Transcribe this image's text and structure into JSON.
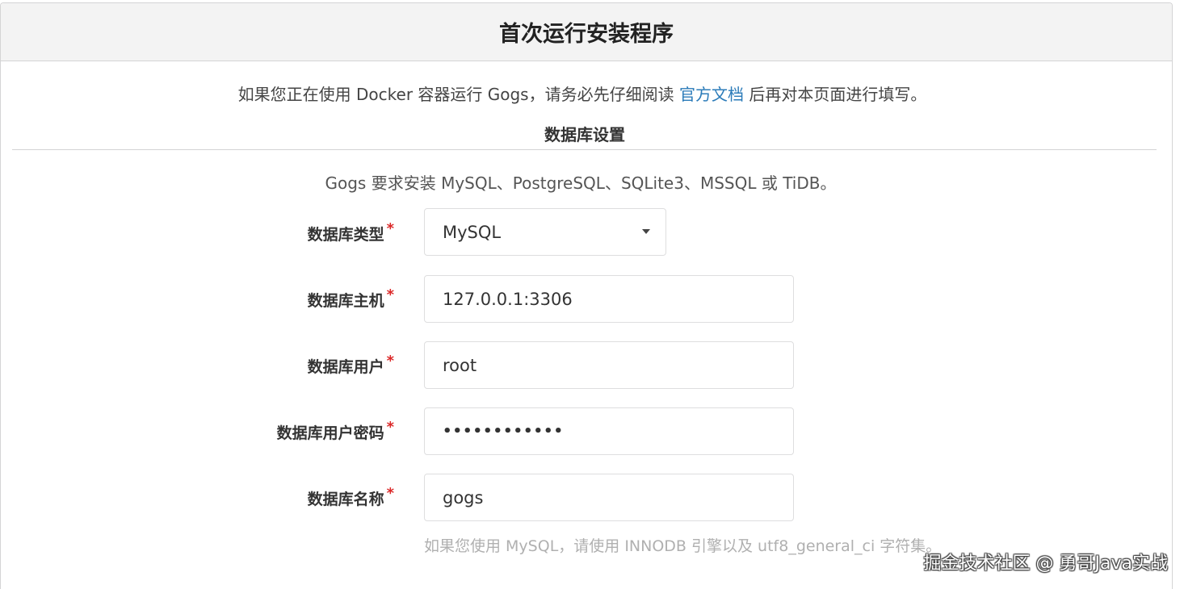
{
  "page": {
    "title": "首次运行安装程序"
  },
  "notice": {
    "before_link": "如果您正在使用 Docker 容器运行 Gogs，请务必先仔细阅读",
    "link_text": "官方文档",
    "after_link": "后再对本页面进行填写。"
  },
  "database": {
    "section_title": "数据库设置",
    "requirement": "Gogs 要求安装 MySQL、PostgreSQL、SQLite3、MSSQL 或 TiDB。",
    "required_mark": "*",
    "fields": {
      "type": {
        "label": "数据库类型",
        "value": "MySQL"
      },
      "host": {
        "label": "数据库主机",
        "value": "127.0.0.1:3306"
      },
      "user": {
        "label": "数据库用户",
        "value": "root"
      },
      "password": {
        "label": "数据库用户密码",
        "value": "••••••••••••"
      },
      "name": {
        "label": "数据库名称",
        "value": "gogs"
      }
    },
    "help_text": "如果您使用 MySQL，请使用 INNODB 引擎以及 utf8_general_ci 字符集。"
  },
  "watermark": "掘金技术社区 @ 勇哥Java实战",
  "colors": {
    "header_bg": "#f3f3f3",
    "link": "#2b7bb9",
    "required": "#db2828",
    "border": "#dededf"
  }
}
